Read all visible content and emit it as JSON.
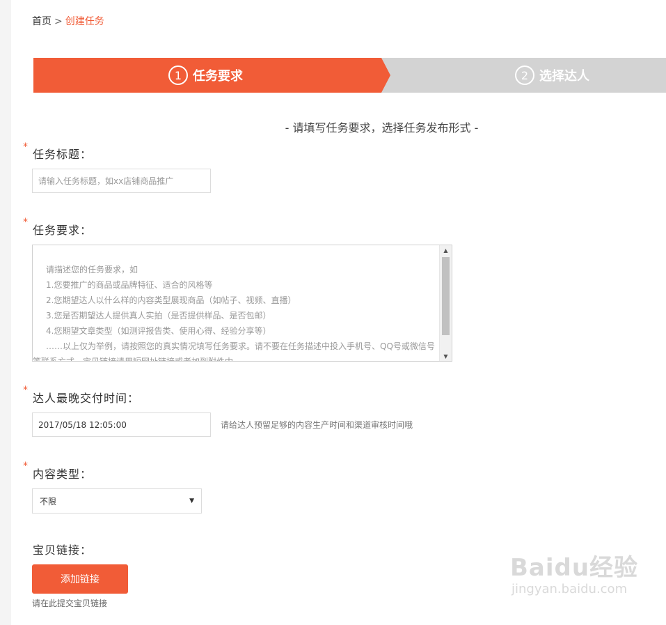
{
  "breadcrumb": {
    "home": "首页",
    "separator": ">",
    "current": "创建任务"
  },
  "steps": [
    {
      "num": "1",
      "label": "任务要求",
      "active": true
    },
    {
      "num": "2",
      "label": "选择达人",
      "active": false
    }
  ],
  "subtitle": "- 请填写任务要求，选择任务发布形式 -",
  "task_title": {
    "label": "任务标题：",
    "placeholder": "请输入任务标题，如xx店铺商品推广"
  },
  "task_req": {
    "label": "任务要求：",
    "placeholder_lines": [
      "请描述您的任务要求，如",
      "1.您要推广的商品或品牌特征、适合的风格等",
      "2.您期望达人以什么样的内容类型展现商品（如帖子、视频、直播）",
      "3.您是否期望达人提供真人实拍（是否提供样品、是否包邮）",
      "4.您期望文章类型（如测评报告类、使用心得、经验分享等）",
      "……以上仅为举例，请按照您的真实情况填写任务要求。请不要在任务描述中投入手机号、QQ号或微信号",
      "等联系方式，宝贝链接请用短网址链接或者加到附件中"
    ]
  },
  "deadline": {
    "label": "达人最晚交付时间：",
    "value": "2017/05/18 12:05:00",
    "hint": "请给达人预留足够的内容生产时间和渠道审核时间哦"
  },
  "content_type": {
    "label": "内容类型：",
    "selected": "不限"
  },
  "product_link": {
    "label": "宝贝链接：",
    "button": "添加链接",
    "hint": "请在此提交宝贝链接"
  },
  "watermark": {
    "brand": "Baidu经验",
    "url": "jingyan.baidu.com"
  },
  "colors": {
    "accent": "#f15c37",
    "step_inactive": "#d3d3d3"
  }
}
